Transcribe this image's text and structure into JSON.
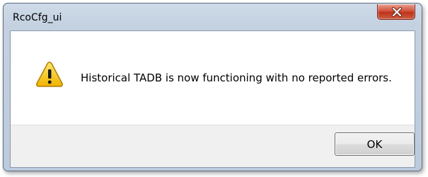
{
  "dialog": {
    "title": "RcoCfg_ui",
    "message": "Historical TADB is now functioning with no reported errors.",
    "icon": "warning-icon",
    "ok_label": "OK",
    "close_icon": "close-icon"
  },
  "colors": {
    "close_button": "#c8452b",
    "warning_fill": "#f5c51c",
    "titlebar": "#c3d1e1"
  }
}
